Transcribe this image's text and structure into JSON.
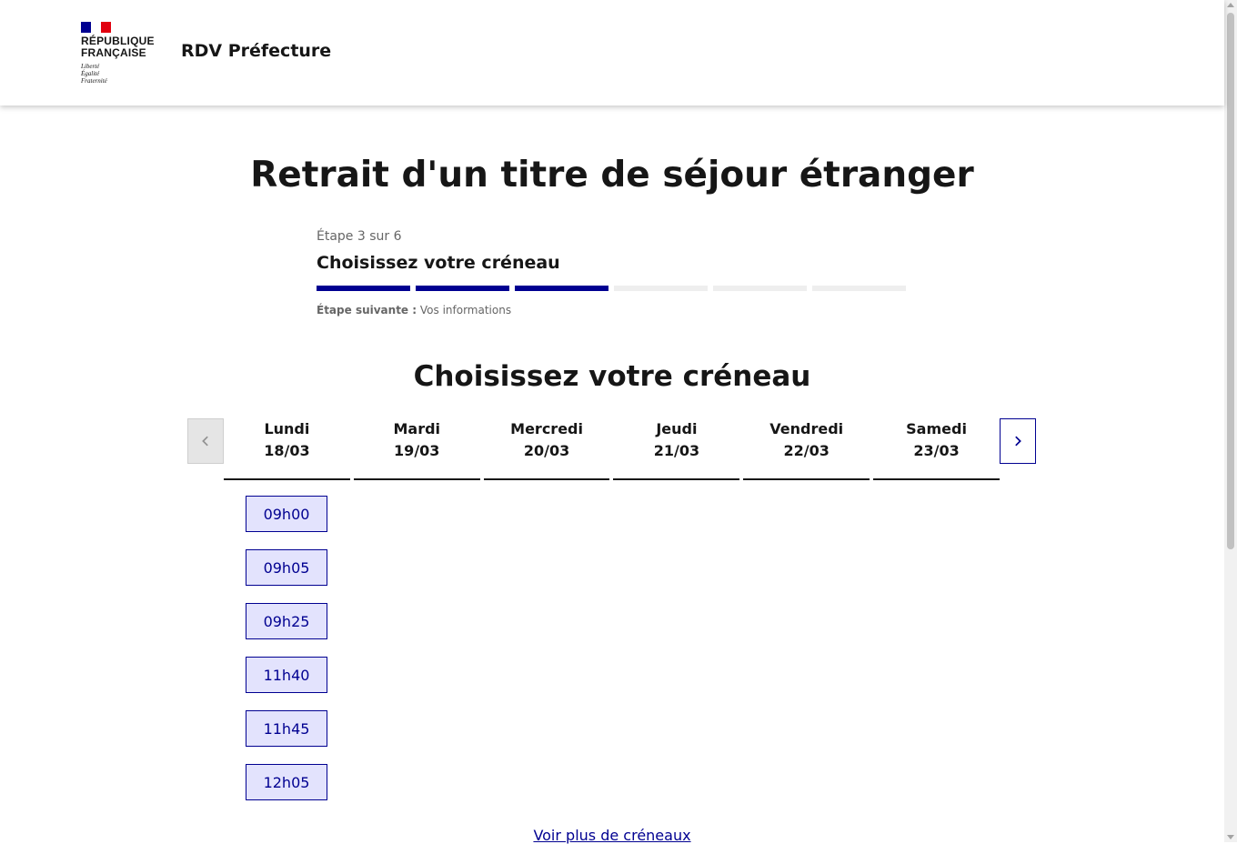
{
  "header": {
    "logo": {
      "line1": "RÉPUBLIQUE",
      "line2": "FRANÇAISE",
      "motto1": "Liberté",
      "motto2": "Égalité",
      "motto3": "Fraternité"
    },
    "service_name": "RDV Préfecture"
  },
  "page": {
    "title": "Retrait d'un titre de séjour étranger"
  },
  "stepper": {
    "state": "Étape 3 sur 6",
    "current_title": "Choisissez votre créneau",
    "total_steps": 6,
    "completed_steps": 3,
    "next_label": "Étape suivante :",
    "next_value": "Vos informations"
  },
  "calendar": {
    "section_title": "Choisissez votre créneau",
    "prev_icon": "chevron-left-icon",
    "next_icon": "chevron-right-icon",
    "days": [
      {
        "name": "Lundi",
        "date": "18/03"
      },
      {
        "name": "Mardi",
        "date": "19/03"
      },
      {
        "name": "Mercredi",
        "date": "20/03"
      },
      {
        "name": "Jeudi",
        "date": "21/03"
      },
      {
        "name": "Vendredi",
        "date": "22/03"
      },
      {
        "name": "Samedi",
        "date": "23/03"
      }
    ],
    "slots_monday": [
      "09h00",
      "09h05",
      "09h25",
      "11h40",
      "11h45",
      "12h05"
    ],
    "more_link": "Voir plus de créneaux"
  },
  "colors": {
    "primary": "#000091",
    "slot_bg": "#e3e3fd",
    "flag_blue": "#000091",
    "flag_red": "#e1000f",
    "step_inactive": "#eeeeee"
  }
}
